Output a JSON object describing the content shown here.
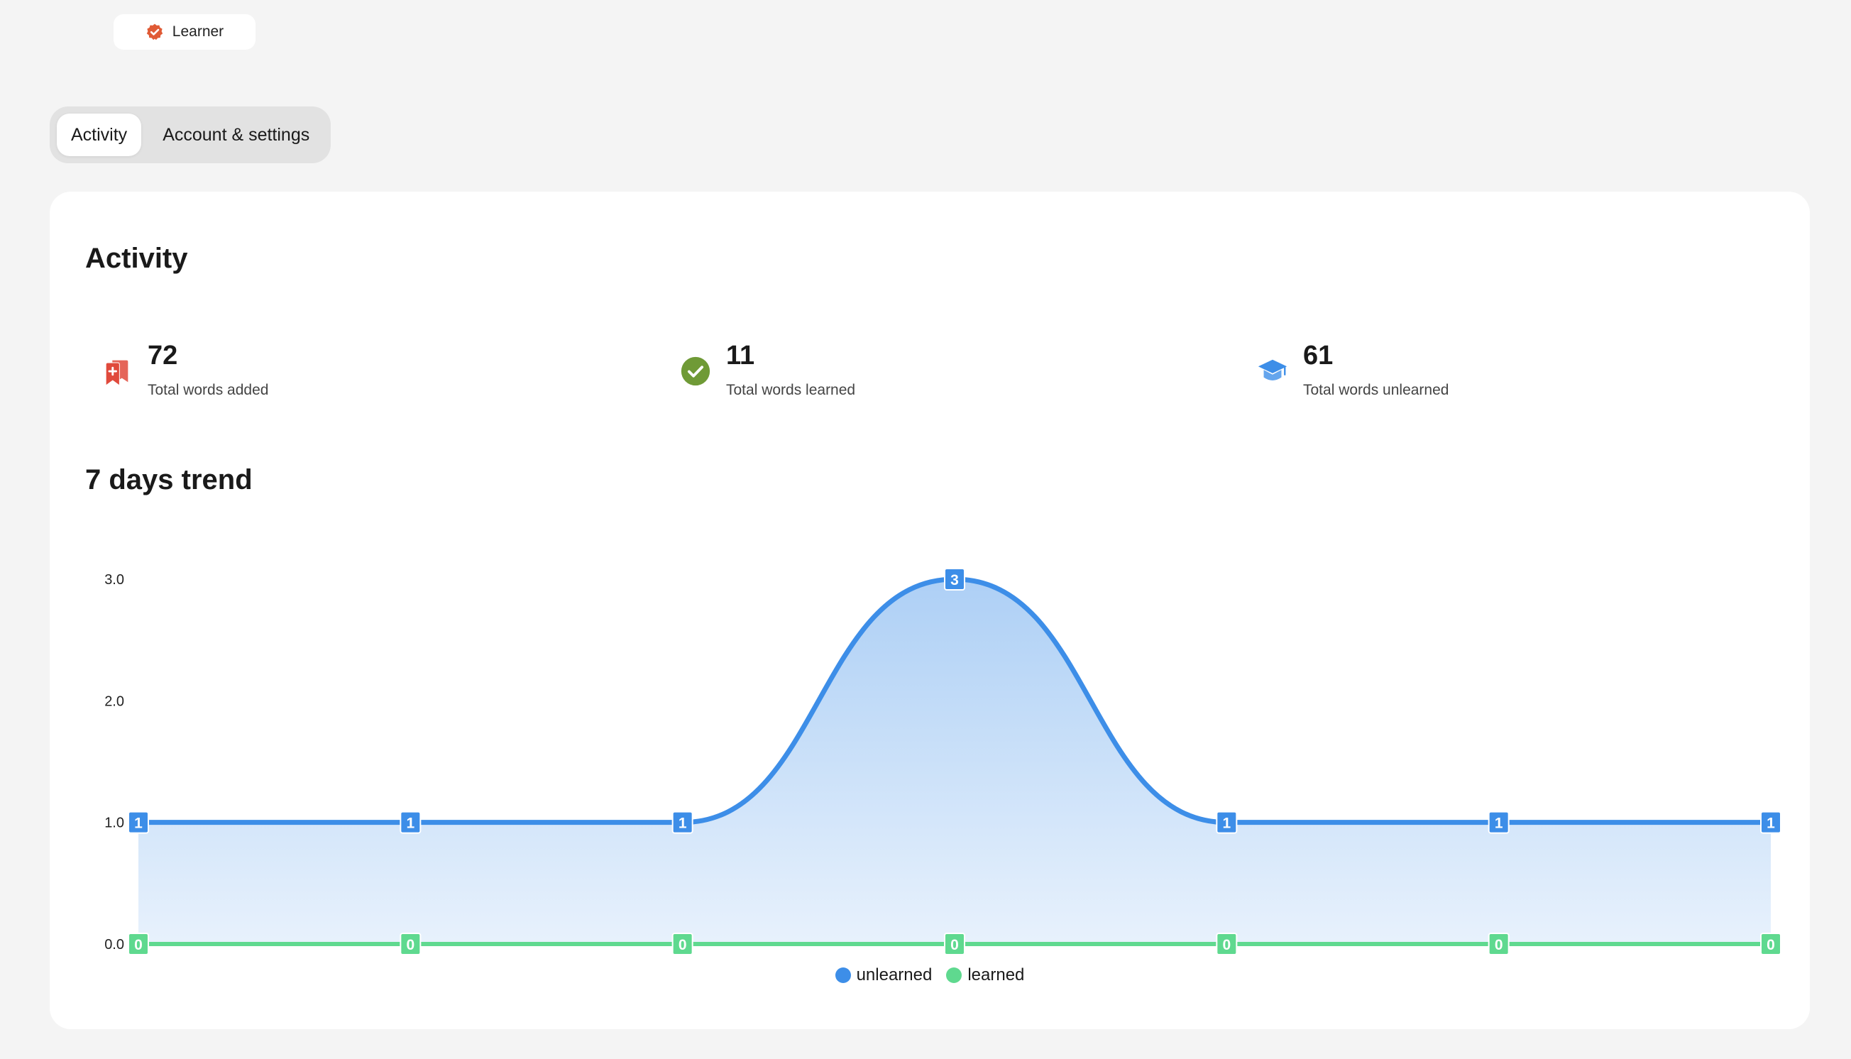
{
  "badge": {
    "label": "Learner",
    "color": "#e05a35"
  },
  "tabs": [
    {
      "label": "Activity",
      "active": true
    },
    {
      "label": "Account & settings",
      "active": false
    }
  ],
  "activity": {
    "title": "Activity"
  },
  "stats": [
    {
      "value": "72",
      "label": "Total words added",
      "icon": "bookmark-plus-icon",
      "bg": "#fff3f3",
      "color": "#e04a3c"
    },
    {
      "value": "11",
      "label": "Total words learned",
      "icon": "check-circle-icon",
      "bg": "#f4f7f2",
      "color": "#6f9a36"
    },
    {
      "value": "61",
      "label": "Total words unlearned",
      "icon": "graduation-cap-icon",
      "bg": "#f1f6fd",
      "color": "#3d8ee8"
    }
  ],
  "trend": {
    "title": "7 days trend"
  },
  "chart_data": {
    "type": "area",
    "x": [
      "",
      "",
      "",
      "",
      "",
      "",
      ""
    ],
    "series": [
      {
        "name": "unlearned",
        "values": [
          1,
          1,
          1,
          3,
          1,
          1,
          1
        ],
        "color": "#3d8ee8"
      },
      {
        "name": "learned",
        "values": [
          0,
          0,
          0,
          0,
          0,
          0,
          0
        ],
        "color": "#5fd98f"
      }
    ],
    "yticks": [
      "0.0",
      "1.0",
      "2.0",
      "3.0"
    ],
    "ylim": [
      0,
      3
    ],
    "grid": false,
    "legend": "bottom-center",
    "data_labels": true
  }
}
